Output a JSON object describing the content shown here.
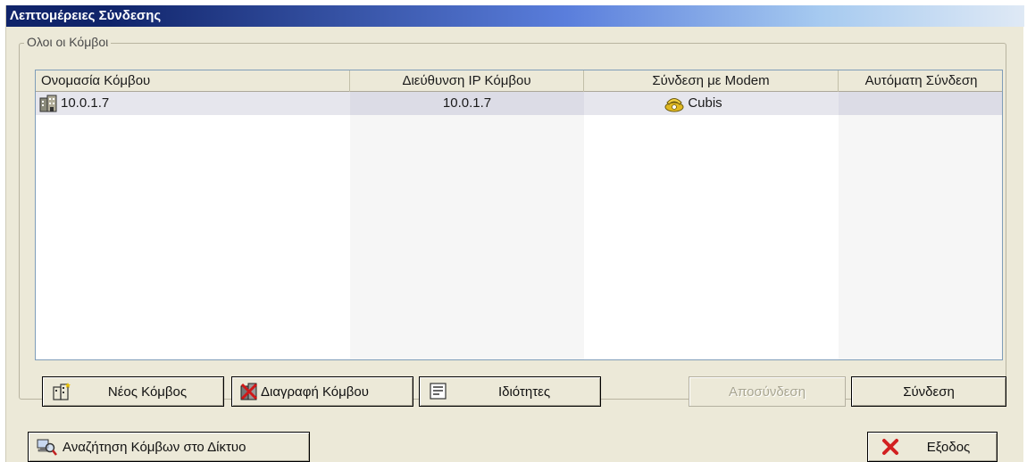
{
  "window": {
    "title": "Λεπτομέρειες Σύνδεσης"
  },
  "group": {
    "legend": "Ολοι οι Κόμβοι"
  },
  "table": {
    "columns": [
      "Ονομασία Κόμβου",
      "Διεύθυνση IP Κόμβου",
      "Σύνδεση με Modem",
      "Αυτόματη Σύνδεση"
    ],
    "rows": [
      {
        "name": "10.0.1.7",
        "ip": "10.0.1.7",
        "modem": "Cubis",
        "auto": "",
        "name_icon": "building-icon",
        "modem_icon": "phone-icon"
      }
    ]
  },
  "buttons": {
    "new_node": "Νέος Κόμβος",
    "delete_node": "Διαγραφή Κόμβου",
    "properties": "Ιδιότητες",
    "disconnect": "Αποσύνδεση",
    "connect": "Σύνδεση",
    "search_network": "Αναζήτηση Κόμβων στο Δίκτυο",
    "exit": "Εξοδος"
  },
  "colors": {
    "title_bar": "#10246a",
    "window_bg": "#ece9d8",
    "selected_row": "#e6e6ed",
    "exit_icon": "#d22020"
  }
}
